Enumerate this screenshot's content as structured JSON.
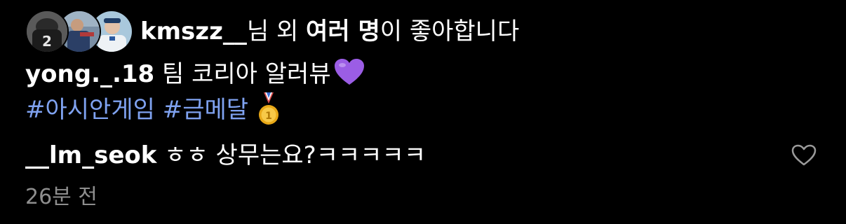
{
  "likes": {
    "username": "kmszz__",
    "suffix_1": "님 외 ",
    "others_bold": "여러 명",
    "suffix_2": "이 좋아합니다"
  },
  "caption": {
    "username": "yong._.18",
    "text": " 팀 코리아 알러뷰",
    "emoji": "purple-heart"
  },
  "hashtags": {
    "tag_1": "#아시안게임",
    "tag_2": "#금메달",
    "emoji": "gold-medal"
  },
  "comment": {
    "username": "__lm_seok",
    "text": " ㅎㅎ 상무는요?ㅋㅋㅋㅋㅋ"
  },
  "timestamp": "26분 전",
  "colors": {
    "background": "#000000",
    "text": "#ffffff",
    "hashtag": "#7fa2f0",
    "muted": "#8e8e8e",
    "heart_emoji": "#9b5de5"
  }
}
